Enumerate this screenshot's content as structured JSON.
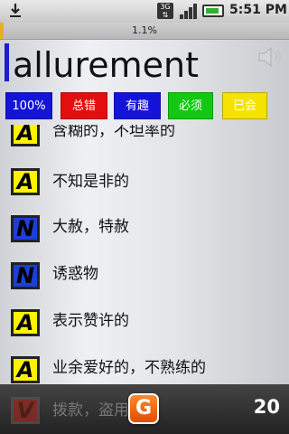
{
  "status_bar": {
    "time": "5:51 PM",
    "network": "3G",
    "icons": [
      "download-icon",
      "3g-icon",
      "signal-icon",
      "battery-icon"
    ]
  },
  "progress": {
    "text": "1.1%",
    "value": 0.011
  },
  "word": "allurement",
  "buttons": [
    {
      "label": "100%",
      "color": "#1414d8"
    },
    {
      "label": "总错",
      "color": "#e50e0e"
    },
    {
      "label": "有趣",
      "color": "#1414d8"
    },
    {
      "label": "必须",
      "color": "#12c812"
    },
    {
      "label": "已会",
      "color": "#f6e200"
    }
  ],
  "items": [
    {
      "pos": "A",
      "meaning": "含糊的，不坦率的"
    },
    {
      "pos": "A",
      "meaning": "不知是非的"
    },
    {
      "pos": "N",
      "meaning": "大赦，特赦"
    },
    {
      "pos": "N",
      "meaning": "诱惑物"
    },
    {
      "pos": "A",
      "meaning": "表示赞许的"
    },
    {
      "pos": "A",
      "meaning": "业余爱好的，不熟练的"
    }
  ],
  "bottom": {
    "pos": "V",
    "meaning": "拨款，盗用",
    "g_label": "G",
    "count": "20"
  }
}
